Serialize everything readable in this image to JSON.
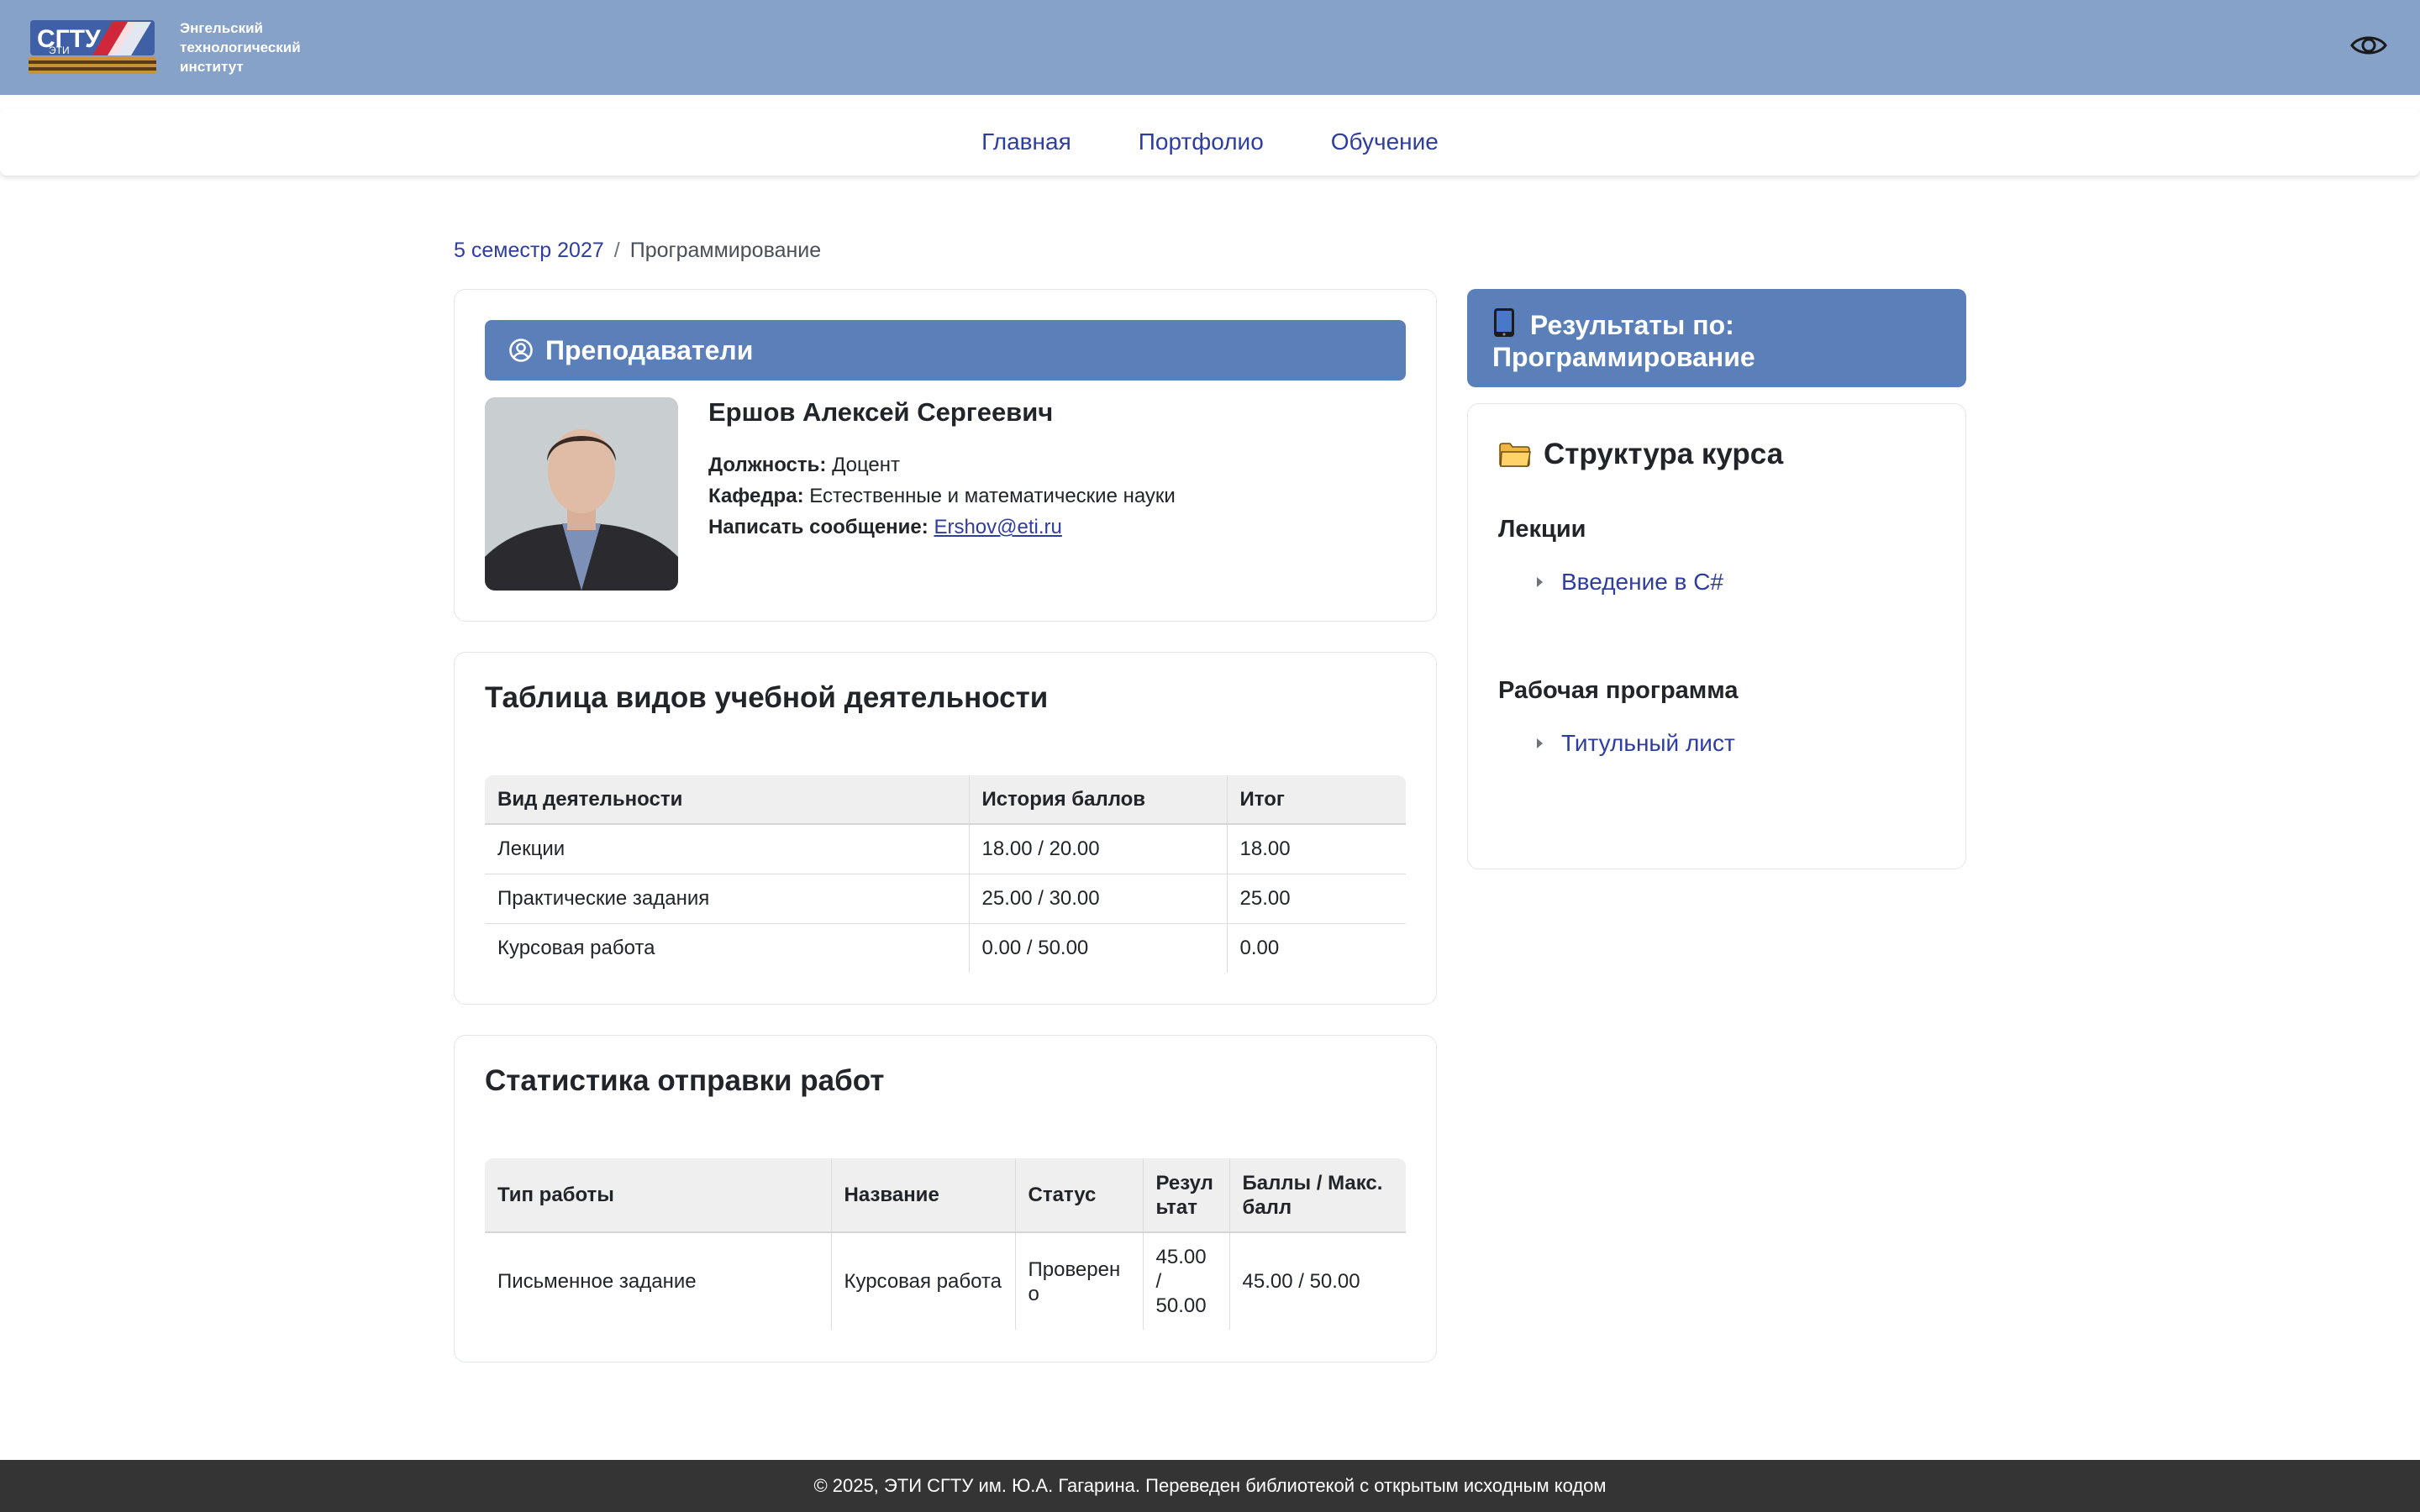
{
  "header": {
    "logo_text_lines": [
      "Энгельский",
      "технологический",
      "институт"
    ],
    "logo_mark_text": "СГТУ",
    "logo_sub_text": "ЭТИ",
    "accessibility_icon": "eye-icon"
  },
  "nav": {
    "items": [
      {
        "label": "Главная"
      },
      {
        "label": "Портфолио"
      },
      {
        "label": "Обучение"
      }
    ]
  },
  "breadcrumb": {
    "parent": "5 семестр 2027",
    "separator": "/",
    "current": "Программирование"
  },
  "teachers": {
    "title": "Преподаватели",
    "icon": "user-circle-icon",
    "name": "Ершов Алексей Сергеевич",
    "position_label": "Должность:",
    "position_value": "Доцент",
    "department_label": "Кафедра:",
    "department_value": "Естественные и математические науки",
    "message_label": "Написать сообщение:",
    "email": "Ershov@eti.ru"
  },
  "activity": {
    "title": "Таблица видов учебной деятельности",
    "headers": [
      "Вид деятельности",
      "История баллов",
      "Итог"
    ],
    "rows": [
      [
        "Лекции",
        "18.00 / 20.00",
        "18.00"
      ],
      [
        "Практические задания",
        "25.00 / 30.00",
        "25.00"
      ],
      [
        "Курсовая работа",
        "0.00 / 50.00",
        "0.00"
      ]
    ]
  },
  "stats": {
    "title": "Статистика отправки работ",
    "headers": [
      "Тип работы",
      "Название",
      "Статус",
      "Резул ьтат",
      "Баллы / Макс. балл"
    ],
    "rows": [
      [
        "Письменное задание",
        "Курсовая работа",
        "Проверен о",
        "45.00 / 50.00",
        "45.00 / 50.00"
      ]
    ]
  },
  "results": {
    "title": "Результаты по: Программирование",
    "icon": "tablet-icon"
  },
  "structure": {
    "title": "Структура курса",
    "icon": "folder-icon",
    "sections": [
      {
        "title": "Лекции",
        "items": [
          "Введение в C#"
        ]
      },
      {
        "title": "Рабочая программа",
        "items": [
          "Титульный лист"
        ]
      }
    ]
  },
  "footer": {
    "text": "© 2025, ЭТИ СГТУ им. Ю.А. Гагарина. Переведен библиотекой с открытым исходным кодом"
  },
  "colors": {
    "header_bg": "#87a2c8",
    "accent_blue": "#5b7fb8",
    "link": "#2f3e9e",
    "footer_bg": "#343434"
  }
}
